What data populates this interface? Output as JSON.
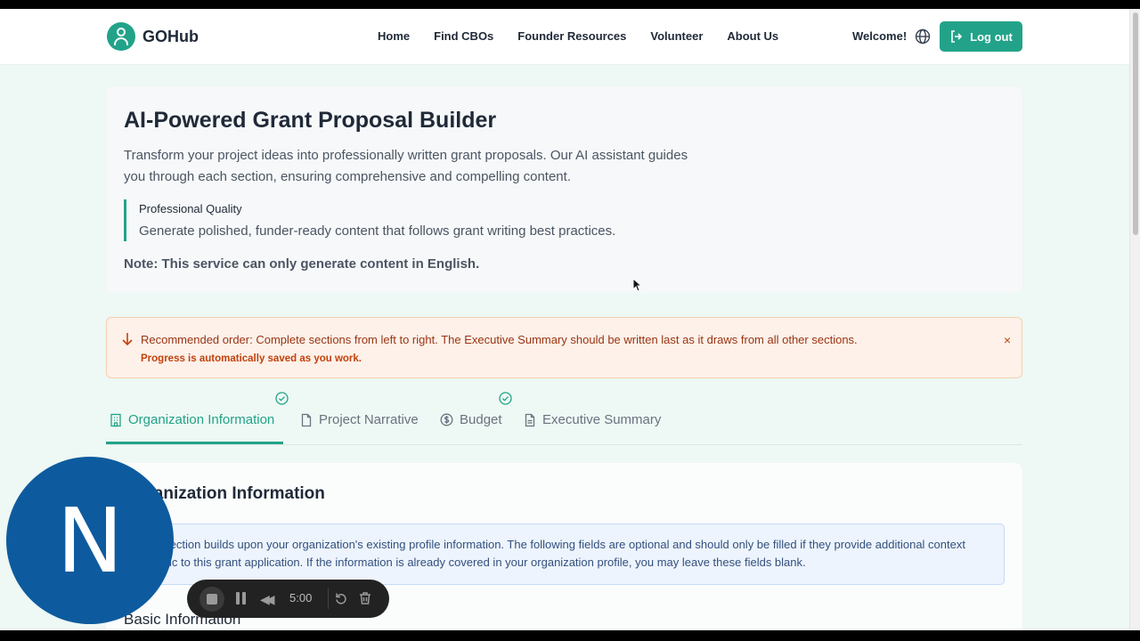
{
  "brand": {
    "name": "GOHub",
    "accent": "#22a389"
  },
  "nav": [
    "Home",
    "Find CBOs",
    "Founder Resources",
    "Volunteer",
    "About Us"
  ],
  "header": {
    "welcome": "Welcome!",
    "globe_icon": "globe-icon",
    "logout_label": "Log out"
  },
  "hero": {
    "title": "AI-Powered Grant Proposal Builder",
    "description": "Transform your project ideas into professionally written grant proposals. Our AI assistant guides you through each section, ensuring comprehensive and compelling content.",
    "quote_title": "Professional Quality",
    "quote_text": "Generate polished, funder-ready content that follows grant writing best practices.",
    "note": "Note: This service can only generate content in English."
  },
  "alert": {
    "message": "Recommended order: Complete sections from left to right. The Executive Summary should be written last as it draws from all other sections.",
    "submessage": "Progress is automatically saved as you work.",
    "close": "×"
  },
  "tabs": [
    {
      "label": "Organization Information",
      "active": true,
      "completed": true
    },
    {
      "label": "Project Narrative",
      "active": false,
      "completed": false
    },
    {
      "label": "Budget",
      "active": false,
      "completed": true
    },
    {
      "label": "Executive Summary",
      "active": false,
      "completed": false
    }
  ],
  "section": {
    "title": "Organization Information",
    "info": "This section builds upon your organization's existing profile information. The following fields are optional and should only be filled if they provide additional context specific to this grant application. If the information is already covered in your organization profile, you may leave these fields blank.",
    "subheading": "Basic Information"
  },
  "overlay": {
    "avatar_letter": "N",
    "recorder_time": "5:00"
  }
}
